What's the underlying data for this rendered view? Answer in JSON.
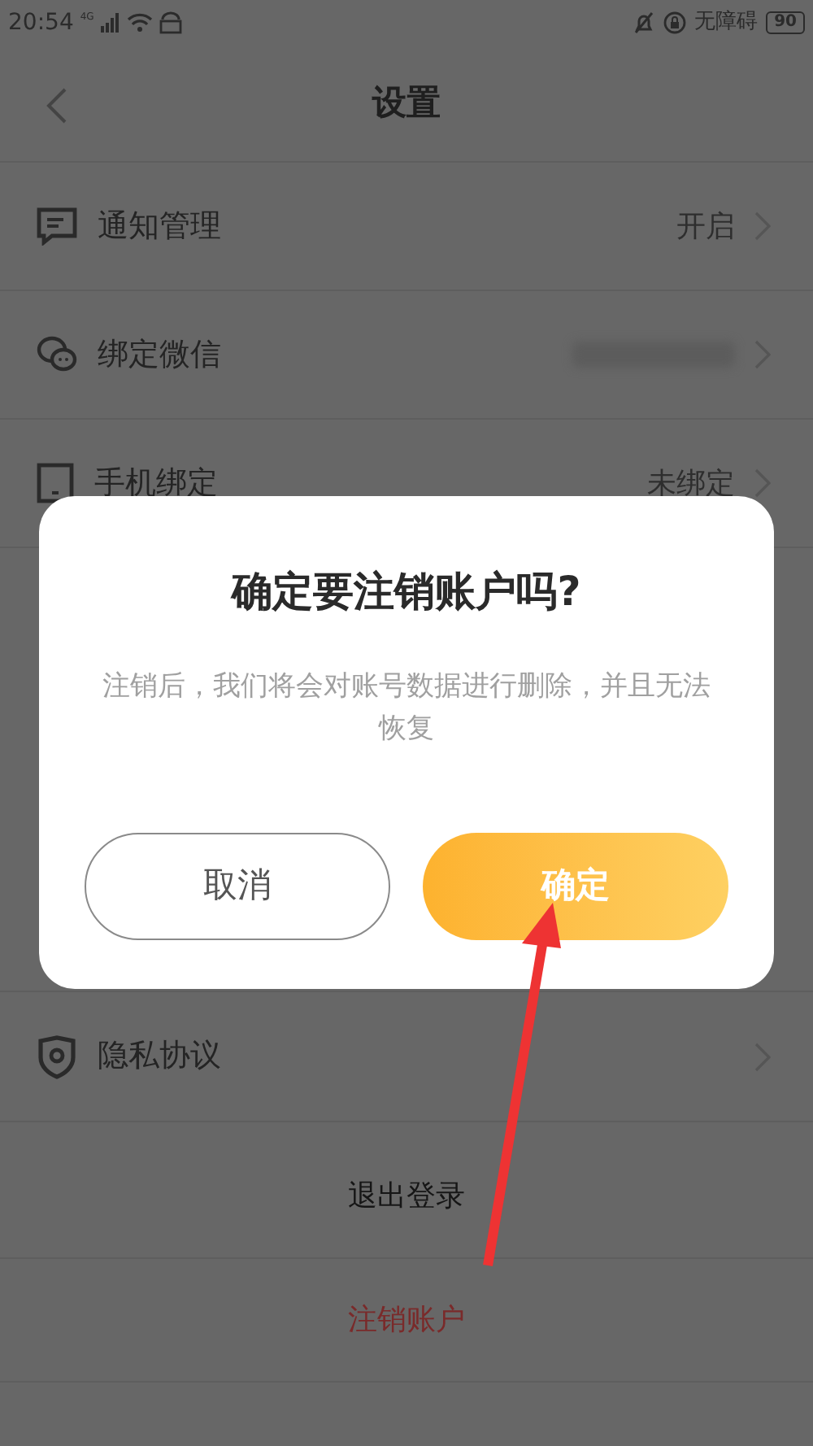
{
  "status_bar": {
    "time": "20:54",
    "network": "4G",
    "accessibility": "无障碍",
    "battery": "90"
  },
  "header": {
    "title": "设置"
  },
  "settings": [
    {
      "kind": "notify",
      "label": "通知管理",
      "value": "开启"
    },
    {
      "kind": "wechat",
      "label": "绑定微信",
      "redacted": true
    },
    {
      "kind": "phone",
      "label": "手机绑定",
      "value": "未绑定"
    }
  ],
  "lower_settings": [
    {
      "kind": "privacy",
      "label": "隐私协议"
    }
  ],
  "actions": [
    {
      "label": "退出登录",
      "danger": false
    },
    {
      "label": "注销账户",
      "danger": true
    }
  ],
  "dialog": {
    "title": "确定要注销账户吗?",
    "message": "注销后，我们将会对账号数据进行删除，并且无法恢复",
    "buttons": [
      {
        "label": "取消",
        "primary": false
      },
      {
        "label": "确定",
        "primary": true
      }
    ]
  }
}
